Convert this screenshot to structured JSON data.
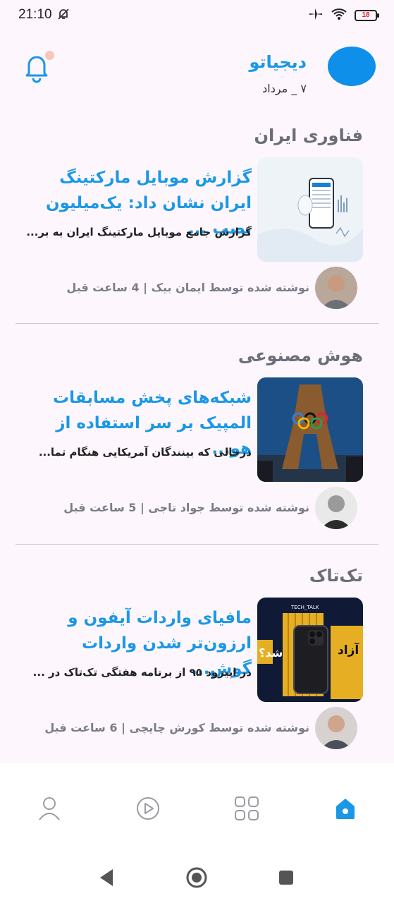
{
  "status": {
    "time": "21:10",
    "battery": "18"
  },
  "header": {
    "brand": "دیجیاتو",
    "date": "۷ _ مرداد"
  },
  "articles": [
    {
      "category": "فناوری ایران",
      "headline": "گزارش موبایل مارکتینگ ایران نشان داد: یک‌میلیون نصب ...",
      "excerpt": "گزارش جامع موبایل مارکتینگ ایران به بر...",
      "byline": "نوشته شده توسط ایمان بیک | 4 ساعت قبل"
    },
    {
      "category": "هوش مصنوعی",
      "headline": "شبکه‌های پخش مسابقات المپیک بر سر استفاده از هو...",
      "excerpt": "درحالی که بینندگان آمریکایی هنگام تما...",
      "byline": "نوشته شده توسط جواد تاجی | 5 ساعت قبل"
    },
    {
      "category": "تک‌تاک",
      "headline": "مافیای واردات آیفون و ارزون‌تر شدن واردات گوش...",
      "excerpt": "در اپیزود ۹۵ از برنامه هفتگی تک‌تاک در ...",
      "byline": "نوشته شده توسط کورش چایچی | 6 ساعت قبل",
      "thumb_text_1": "آزاد",
      "thumb_text_2": "شد؟",
      "thumb_tag": "TECH_TALK"
    }
  ],
  "nav": {
    "items": [
      "profile-icon",
      "video-icon",
      "categories-icon",
      "home-icon"
    ],
    "active": "home-icon",
    "accent": "#1a98e6"
  }
}
